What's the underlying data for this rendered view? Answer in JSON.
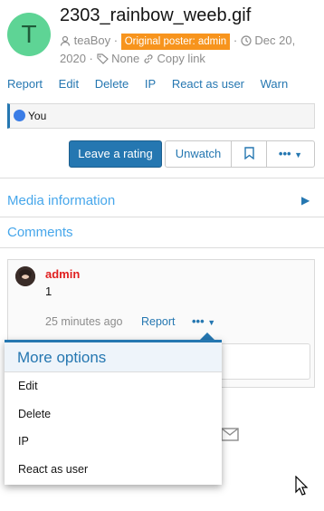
{
  "media": {
    "avatar_letter": "T",
    "title": "2303_rainbow_weeb.gif",
    "username": "teaBoy",
    "badge": "Original poster: admin",
    "date": "Dec 20, 2020",
    "tags": "None",
    "copy_link": "Copy link",
    "sep": "·"
  },
  "actions": [
    "Report",
    "Edit",
    "Delete",
    "IP",
    "React as user",
    "Warn"
  ],
  "reactions": {
    "label": "You"
  },
  "buttons": {
    "rating": "Leave a rating",
    "unwatch": "Unwatch",
    "more": "•••"
  },
  "sections": {
    "media_info": "Media information",
    "comments": "Comments"
  },
  "comment": {
    "author": "admin",
    "text": "1",
    "time": "25 minutes ago",
    "report": "Report",
    "more": "•••"
  },
  "menu": {
    "title": "More options",
    "items": [
      "Edit",
      "Delete",
      "IP",
      "React as user"
    ]
  },
  "colors": {
    "accent": "#2577b1",
    "badge": "#f7941d",
    "avatar": "#5ed495",
    "author": "#e02020"
  }
}
